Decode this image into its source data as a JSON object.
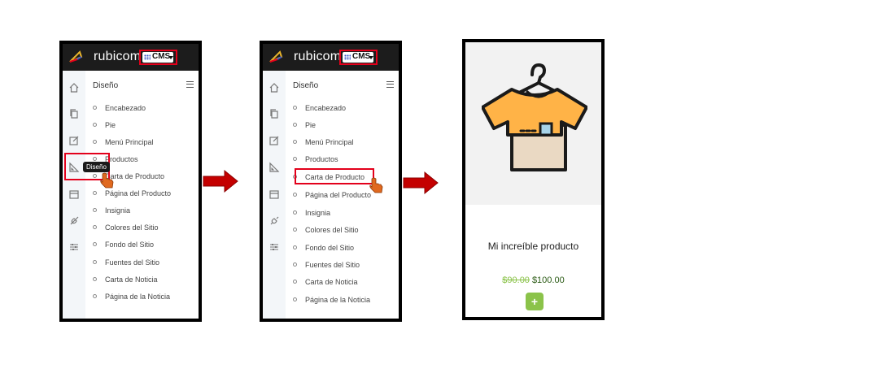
{
  "app": {
    "brand": "rubicom",
    "cms_label": "CMS"
  },
  "menu": {
    "title": "Diseño",
    "items": [
      "Encabezado",
      "Pie",
      "Menú Principal",
      "Productos",
      "Carta de Producto",
      "Página del Producto",
      "Insignia",
      "Colores del Sitio",
      "Fondo del Sitio",
      "Fuentes del Sitio",
      "Carta de Noticia",
      "Página de la Noticia"
    ]
  },
  "tooltip": {
    "text": "Diseño"
  },
  "rail_icons": [
    "home-icon",
    "copy-icon",
    "edit-icon",
    "design-ruler-icon",
    "box-icon",
    "rocket-icon",
    "sliders-icon"
  ],
  "product": {
    "name": "Mi increíble producto",
    "old_price": "$90.00",
    "new_price": "$100.00",
    "add_label": "+"
  },
  "colors": {
    "highlight": "#e3001b",
    "arrow": "#c40000",
    "accent_green": "#8bc34a",
    "topbar": "#1c1c1c"
  }
}
